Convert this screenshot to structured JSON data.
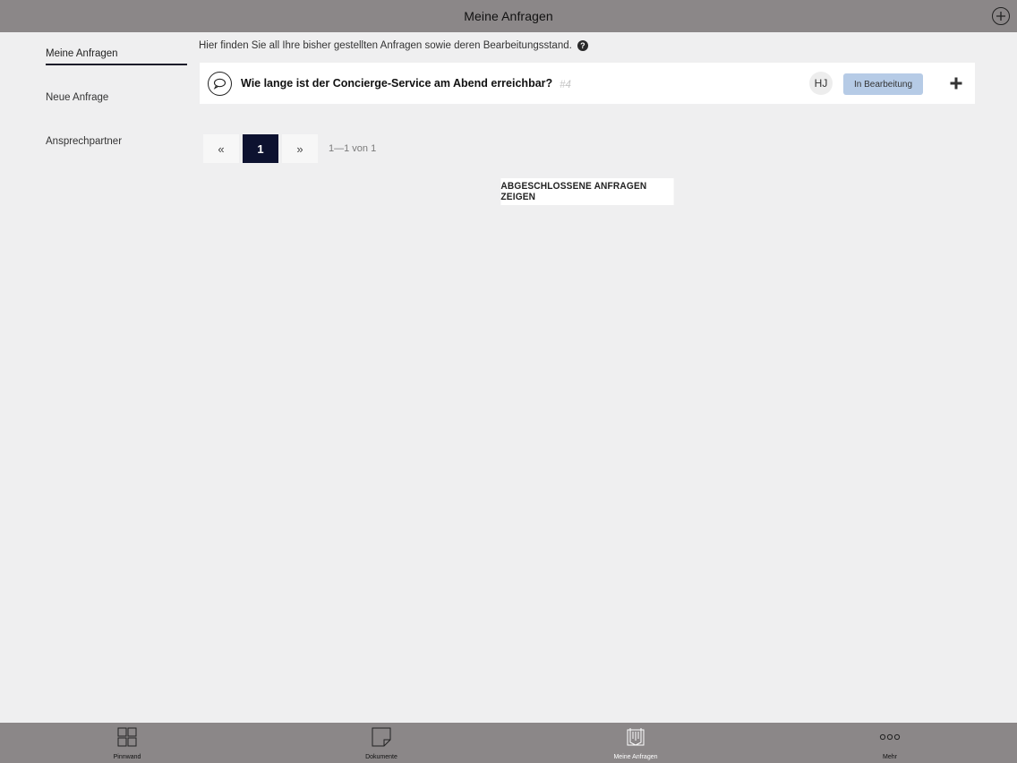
{
  "header": {
    "title": "Meine Anfragen"
  },
  "sidebar": {
    "items": [
      {
        "label": "Meine Anfragen"
      },
      {
        "label": "Neue Anfrage"
      },
      {
        "label": "Ansprechpartner"
      }
    ]
  },
  "main": {
    "intro": "Hier finden Sie all Ihre bisher gestellten Anfragen sowie deren Bearbeitungsstand.",
    "requests": [
      {
        "title": "Wie lange ist der Concierge-Service am Abend erreichbar?",
        "id": "#4",
        "assignee_initials": "HJ",
        "status": "In Bearbeitung",
        "status_color": "#b6cbe6"
      }
    ],
    "pagination": {
      "prev_label": "«",
      "current_page": "1",
      "next_label": "»",
      "info": "1—1 von 1"
    },
    "closed_button": "ABGESCHLOSSENE ANFRAGEN ZEIGEN"
  },
  "tabbar": {
    "tabs": [
      {
        "label": "Pinnwand",
        "icon": "grid-icon"
      },
      {
        "label": "Dokumente",
        "icon": "document-icon"
      },
      {
        "label": "Meine Anfragen",
        "icon": "requests-icon",
        "active": true
      },
      {
        "label": "Mehr",
        "icon": "more-icon"
      }
    ]
  },
  "colors": {
    "bar": "#8b8788",
    "background": "#efeff0",
    "active_page": "#0d1230"
  }
}
